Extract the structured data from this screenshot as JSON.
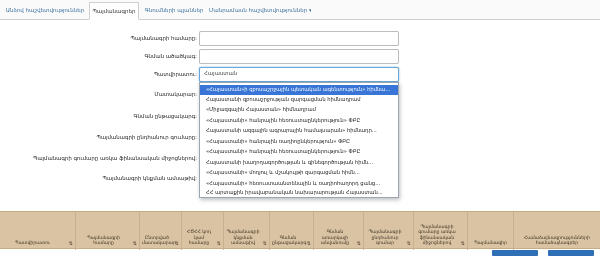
{
  "tabs": [
    {
      "label": "Անձով հաշվետվություններ"
    },
    {
      "label": "Պայմանագրեր"
    },
    {
      "label": "Գնումների պլաններ"
    },
    {
      "label": "Մանրամասն հաշվետվություններ ▾"
    }
  ],
  "form": {
    "contract_number_label": "Պայմանագրի համարը:",
    "procurement_code_label": "Գնման ածածկագ:",
    "customer_label": "Պատվիրատու:",
    "customer_value": "Հայաստան",
    "supplier_label": "Մատակարար:",
    "procurement_form_label": "Գնման ընթացակարգ:",
    "contract_amount_label": "Պայմանագրի ընդհանուր գումարը:",
    "financial_means_label": "Պայմանագրի գումարը առկա ֆինանսական միջոցներով:",
    "signing_date_label": "Պայմանագրի կնքման ամսաթիվ:"
  },
  "dropdown": {
    "items": [
      "«Հայաստան»ի զբոսաշրջային պետական ագենտություն» հիմնա...",
      "Հայաստանի զբոսաշրջության զարգացման հիմնադրամ",
      "«Միջազգային Հայաստան» հիմնադրամ",
      "«Հայաստանի» հանրային հեռուստաընկերություն» ՓԲԸ",
      "Հայաստանի ազգային ագրարային համալսարան» հիմնադր...",
      "«Հայաստանի» հանրային ռադիոընկերություն» ՓԲԸ",
      "«Հայաստանի» հանրային հեռուստաընկերություն» ՓԲԸ",
      "Հայաստանի խաղողագործության և գինեգործության հիմն...",
      "«Հայաստանի» մոդյուլ և մշակույթի զարգացման հիմն...",
      "«Հայաստանի» հեռուստաանտենային և ռադիոհաղորդ ցանց...",
      "ՀՀ արտաքին իրավաբանական նախարարության Հայաստան..."
    ]
  },
  "grid": {
    "columns": [
      "Պատվիրատու",
      "Պայմանագրի համարը",
      "Ընտրված մատակարար",
      "ՀԾՀՀ կոդ կամ համարը",
      "Պայմանագրի կնքման ամսաթիվ",
      "Գնման ընթացակարգ",
      "Գնման առարկայի անվանումը",
      "Պայմանագրի ընդհանուր գումար",
      "Պայմանագրի գումարը առկա ֆինանսական միջոցներով",
      "Պայմանագիր",
      "Համաձայնագրությունների համաձայնագրեր"
    ]
  }
}
